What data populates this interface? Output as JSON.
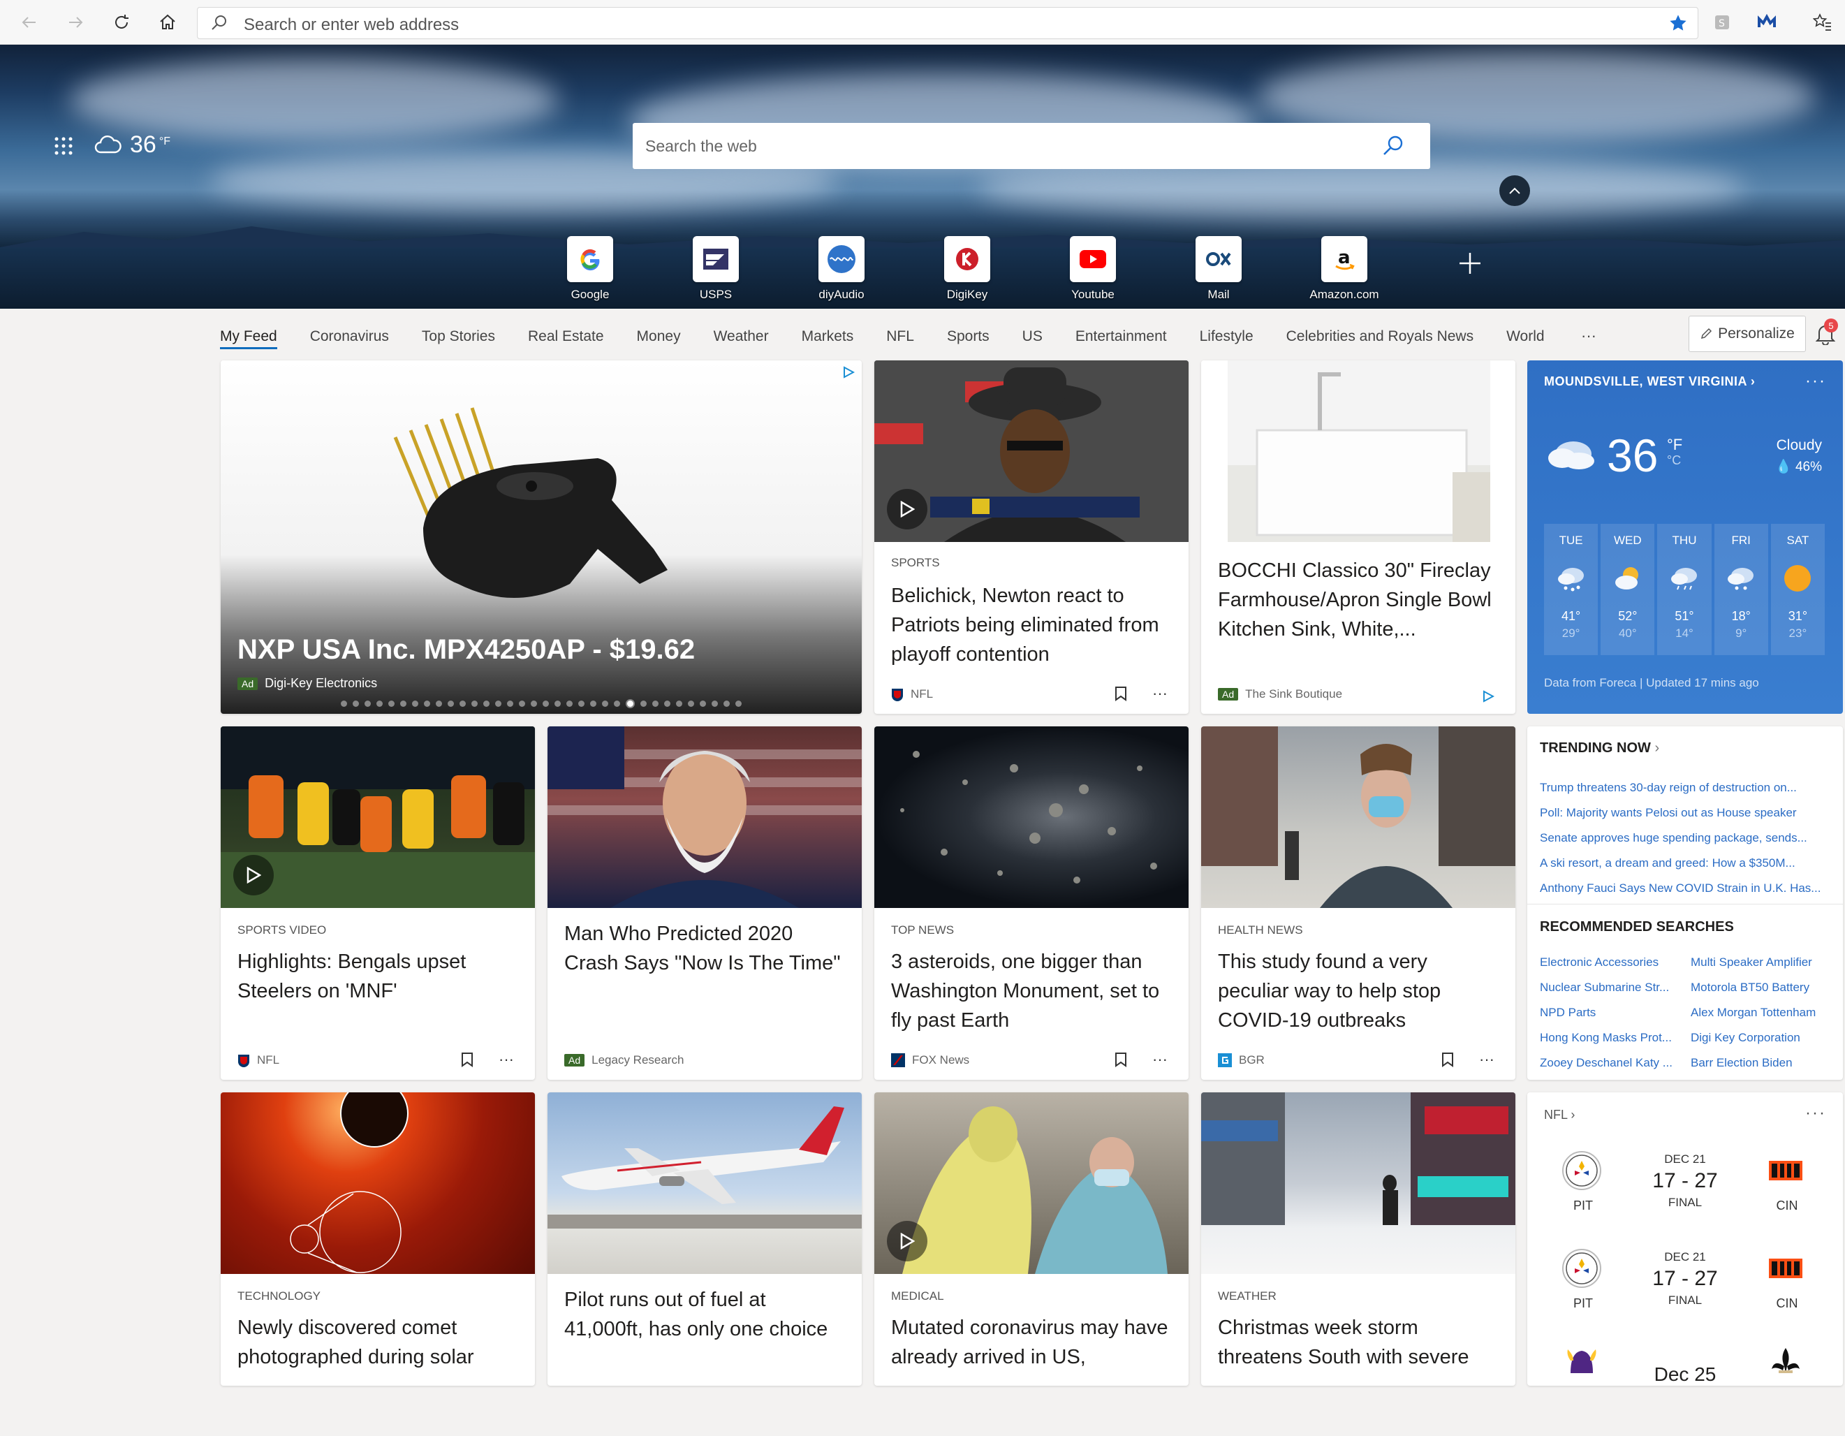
{
  "browser": {
    "address_placeholder": "Search or enter web address"
  },
  "hero": {
    "temperature": "36",
    "unit": "°F",
    "search_placeholder": "Search the web",
    "quick_links": [
      {
        "label": "Google"
      },
      {
        "label": "USPS"
      },
      {
        "label": "diyAudio"
      },
      {
        "label": "DigiKey"
      },
      {
        "label": "Youtube"
      },
      {
        "label": "Mail"
      },
      {
        "label": "Amazon.com"
      }
    ]
  },
  "nav": {
    "items": [
      "My Feed",
      "Coronavirus",
      "Top Stories",
      "Real Estate",
      "Money",
      "Weather",
      "Markets",
      "NFL",
      "Sports",
      "US",
      "Entertainment",
      "Lifestyle",
      "Celebrities and Royals News",
      "World"
    ],
    "more": "···",
    "personalize": "Personalize",
    "notification_count": "5"
  },
  "feed": {
    "ad": {
      "title": "NXP USA Inc. MPX4250AP - $19.62",
      "badge": "Ad",
      "source": "Digi-Key Electronics",
      "carousel_count": 34,
      "carousel_active": 24
    },
    "cards": [
      {
        "category": "SPORTS",
        "headline": "Belichick, Newton react to Patriots being eliminated from playoff contention",
        "source": "NFL"
      },
      {
        "category": "",
        "headline": "BOCCHI Classico 30\" Fireclay Farmhouse/Apron Single Bowl Kitchen Sink, White,...",
        "badge": "Ad",
        "source": "The Sink Boutique"
      },
      {
        "category": "SPORTS VIDEO",
        "headline": "Highlights: Bengals upset Steelers on 'MNF'",
        "source": "NFL"
      },
      {
        "category": "",
        "headline": "Man Who Predicted 2020 Crash Says \"Now Is The Time\"",
        "badge": "Ad",
        "source": "Legacy Research"
      },
      {
        "category": "TOP NEWS",
        "headline": "3 asteroids, one bigger than Washington Monument, set to fly past Earth",
        "source": "FOX News"
      },
      {
        "category": "HEALTH NEWS",
        "headline": "This study found a very peculiar way to help stop COVID-19 outbreaks",
        "source": "BGR"
      },
      {
        "category": "TECHNOLOGY",
        "headline": "Newly discovered comet photographed during solar"
      },
      {
        "category": "",
        "headline": "Pilot runs out of fuel at 41,000ft, has only one choice"
      },
      {
        "category": "MEDICAL",
        "headline": "Mutated coronavirus may have already arrived in US,"
      },
      {
        "category": "WEATHER",
        "headline": "Christmas week storm threatens South with severe"
      }
    ]
  },
  "weather": {
    "location": "MOUNDSVILLE, WEST VIRGINIA",
    "more": "···",
    "temp": "36",
    "unit_f": "°F",
    "unit_c": "°C",
    "condition": "Cloudy",
    "humidity": "46%",
    "days": [
      {
        "name": "TUE",
        "hi": "41°",
        "lo": "29°",
        "icon": "cloud-snow-icon"
      },
      {
        "name": "WED",
        "hi": "52°",
        "lo": "40°",
        "icon": "partly-sunny-icon"
      },
      {
        "name": "THU",
        "hi": "51°",
        "lo": "14°",
        "icon": "cloud-rain-icon"
      },
      {
        "name": "FRI",
        "hi": "18°",
        "lo": "9°",
        "icon": "cloud-snow-icon"
      },
      {
        "name": "SAT",
        "hi": "31°",
        "lo": "23°",
        "icon": "sun-icon"
      }
    ],
    "footer": "Data from Foreca | Updated 17 mins ago"
  },
  "trending": {
    "title": "TRENDING NOW",
    "links": [
      "Trump threatens 30-day reign of destruction on...",
      "Poll: Majority wants Pelosi out as House speaker",
      "Senate approves huge spending package, sends...",
      "A ski resort, a dream and greed: How a $350M...",
      "Anthony Fauci Says New COVID Strain in U.K. Has..."
    ],
    "rec_title": "RECOMMENDED SEARCHES",
    "rec_left": [
      "Electronic Accessories",
      "Nuclear Submarine Str...",
      "NPD Parts",
      "Hong Kong Masks Prot...",
      "Zooey Deschanel Katy ..."
    ],
    "rec_right": [
      "Multi Speaker Amplifier",
      "Motorola BT50 Battery",
      "Alex Morgan Tottenham",
      "Digi Key Corporation",
      "Barr Election Biden"
    ]
  },
  "nfl": {
    "title": "NFL",
    "more": "···",
    "games": [
      {
        "date": "DEC 21",
        "score": "17 - 27",
        "status": "FINAL",
        "home": "PIT",
        "away": "CIN"
      },
      {
        "date": "DEC 21",
        "score": "17 - 27",
        "status": "FINAL",
        "home": "PIT",
        "away": "CIN"
      },
      {
        "date": "Dec 25",
        "score": "",
        "status": "",
        "home": "",
        "away": ""
      }
    ]
  },
  "colors": {
    "accent": "#0f6cbd",
    "weather_bg": "#3577c9",
    "link": "#2b6cc4",
    "ad_green": "#3a6a2a"
  }
}
